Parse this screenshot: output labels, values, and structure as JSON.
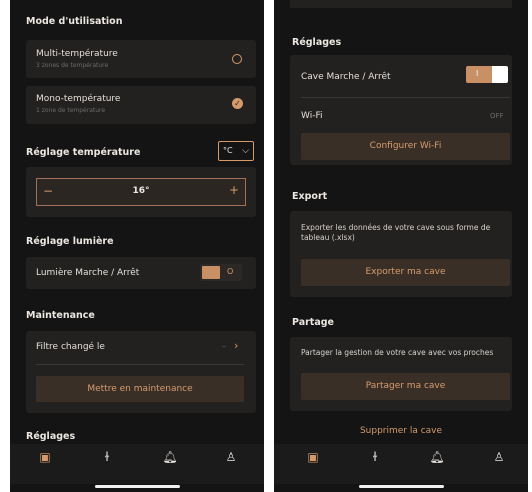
{
  "left": {
    "mode": {
      "title": "Mode d'utilisation",
      "options": [
        {
          "label": "Multi-température",
          "sub": "3 zones de température",
          "selected": false
        },
        {
          "label": "Mono-température",
          "sub": "1 zone de température",
          "selected": true
        }
      ]
    },
    "temperature": {
      "title": "Réglage température",
      "unit": "°C",
      "minus": "−",
      "value": "16°",
      "plus": "+"
    },
    "light": {
      "title": "Réglage lumière",
      "label": "Lumière Marche / Arrêt",
      "toggle_off_label": "O"
    },
    "maintenance": {
      "title": "Maintenance",
      "filter_label": "Filtre changé le",
      "filter_value": "–",
      "button": "Mettre en maintenance"
    },
    "settings_title": "Réglages"
  },
  "right": {
    "settings": {
      "title": "Réglages",
      "power_label": "Cave Marche / Arrêt",
      "toggle_on_label": "I",
      "wifi_label": "Wi-Fi",
      "wifi_status": "OFF",
      "wifi_button": "Configurer Wi-Fi"
    },
    "export": {
      "title": "Export",
      "text": "Exporter les données de votre cave sous forme de tableau (.xlsx)",
      "button": "Exporter ma cave"
    },
    "share": {
      "title": "Partage",
      "text": "Partager la gestion de votre cave avec vos proches",
      "button": "Partager ma cave"
    },
    "delete": "Supprimer la cave"
  },
  "nav": {
    "icons": [
      "wine-cellar-icon",
      "bottle-icon",
      "bell-icon",
      "profile-icon"
    ]
  },
  "colors": {
    "background": "#141414",
    "card": "#222120",
    "accent": "#d59a6c",
    "button_bg": "#3a2f26"
  }
}
